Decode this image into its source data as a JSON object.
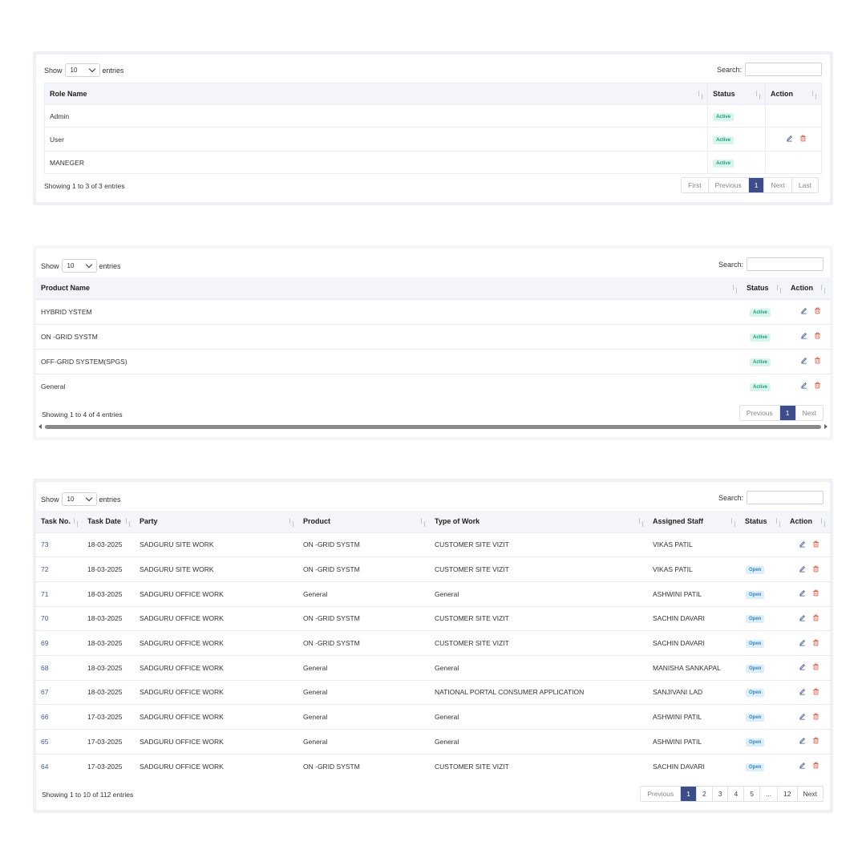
{
  "common": {
    "show_label": "Show",
    "entries_label": "entries",
    "page_size": "10",
    "search_label": "Search:",
    "first": "First",
    "previous": "Previous",
    "next": "Next",
    "last": "Last"
  },
  "roles": {
    "headers": {
      "name": "Role Name",
      "status": "Status",
      "action": "Action"
    },
    "rows": [
      {
        "name": "Admin",
        "status": "Active"
      },
      {
        "name": "User",
        "status": "Active"
      },
      {
        "name": "MANEGER",
        "status": "Active"
      }
    ],
    "info": "Showing 1 to 3 of 3 entries",
    "page": "1"
  },
  "products": {
    "headers": {
      "name": "Product Name",
      "status": "Status",
      "action": "Action"
    },
    "rows": [
      {
        "name": "HYBRID YSTEM",
        "status": "Active"
      },
      {
        "name": "ON -GRID SYSTM",
        "status": "Active"
      },
      {
        "name": "OFF-GRID SYSTEM(SPGS)",
        "status": "Active"
      },
      {
        "name": "General",
        "status": "Active"
      }
    ],
    "info": "Showing 1 to 4 of 4 entries",
    "page": "1"
  },
  "tasks": {
    "headers": {
      "no": "Task No.",
      "date": "Task Date",
      "party": "Party",
      "product": "Product",
      "work": "Type of Work",
      "staff": "Assigned Staff",
      "status": "Status",
      "action": "Action"
    },
    "rows": [
      {
        "no": "73",
        "date": "18-03-2025",
        "party": "SADGURU SITE WORK",
        "product": "ON -GRID SYSTM",
        "work": "CUSTOMER SITE VIZIT",
        "staff": "VIKAS PATIL",
        "status": ""
      },
      {
        "no": "72",
        "date": "18-03-2025",
        "party": "SADGURU SITE WORK",
        "product": "ON -GRID SYSTM",
        "work": "CUSTOMER SITE VIZIT",
        "staff": "VIKAS PATIL",
        "status": "Open"
      },
      {
        "no": "71",
        "date": "18-03-2025",
        "party": "SADGURU OFFICE WORK",
        "product": "General",
        "work": "General",
        "staff": "ASHWINI PATIL",
        "status": "Open"
      },
      {
        "no": "70",
        "date": "18-03-2025",
        "party": "SADGURU OFFICE WORK",
        "product": "ON -GRID SYSTM",
        "work": "CUSTOMER SITE VIZIT",
        "staff": "SACHIN DAVARI",
        "status": "Open"
      },
      {
        "no": "69",
        "date": "18-03-2025",
        "party": "SADGURU OFFICE WORK",
        "product": "ON -GRID SYSTM",
        "work": "CUSTOMER SITE VIZIT",
        "staff": "SACHIN DAVARI",
        "status": "Open"
      },
      {
        "no": "68",
        "date": "18-03-2025",
        "party": "SADGURU OFFICE WORK",
        "product": "General",
        "work": "General",
        "staff": "MANISHA SANKAPAL",
        "status": "Open"
      },
      {
        "no": "67",
        "date": "18-03-2025",
        "party": "SADGURU OFFICE WORK",
        "product": "General",
        "work": "NATIONAL PORTAL CONSUMER APPLICATION",
        "staff": "SANJIVANI LAD",
        "status": "Open"
      },
      {
        "no": "66",
        "date": "17-03-2025",
        "party": "SADGURU OFFICE WORK",
        "product": "General",
        "work": "General",
        "staff": "ASHWINI PATIL",
        "status": "Open"
      },
      {
        "no": "65",
        "date": "17-03-2025",
        "party": "SADGURU OFFICE WORK",
        "product": "General",
        "work": "General",
        "staff": "ASHWINI PATIL",
        "status": "Open"
      },
      {
        "no": "64",
        "date": "17-03-2025",
        "party": "SADGURU OFFICE WORK",
        "product": "ON -GRID SYSTM",
        "work": "CUSTOMER SITE VIZIT",
        "staff": "SACHIN DAVARI",
        "status": "Open"
      }
    ],
    "info": "Showing 1 to 10 of 112 entries",
    "pages": [
      "1",
      "2",
      "3",
      "4",
      "5",
      "...",
      "12"
    ]
  },
  "colors": {
    "accent": "#3d4d8a",
    "edit": "#3d5a99",
    "delete": "#e05a47"
  }
}
